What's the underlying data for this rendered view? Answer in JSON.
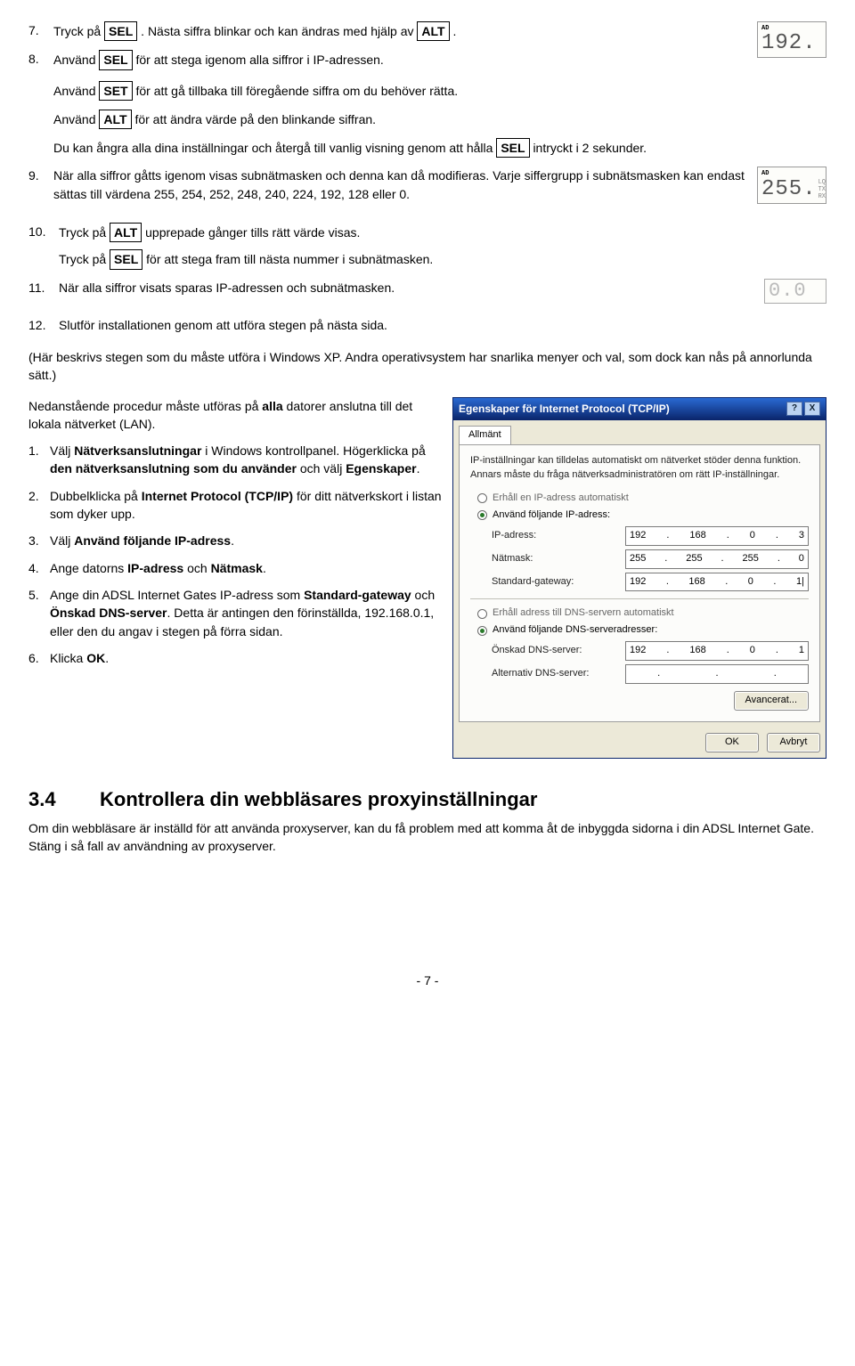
{
  "keys": {
    "SEL": "SEL",
    "ALT": "ALT",
    "SET": "SET"
  },
  "step7": {
    "num": "7.",
    "a": "Tryck på ",
    "b": ". Nästa siffra blinkar och kan ändras med hjälp av ",
    "c": "."
  },
  "step8": {
    "num": "8.",
    "a": "Använd ",
    "b": " för att stega igenom alla siffror i IP-adressen."
  },
  "p8a": {
    "a": "Använd ",
    "b": " för att gå tillbaka till föregående siffra om du behöver rätta."
  },
  "p8b": {
    "a": "Använd ",
    "b": " för att ändra värde på den blinkande siffran."
  },
  "p8c": {
    "a": "Du kan ångra alla dina inställningar och återgå till vanlig visning genom att hålla ",
    "b": " intryckt i 2 sekunder."
  },
  "step9": {
    "num": "9.",
    "text": "När alla siffror gåtts igenom visas subnätmasken och denna kan då modifieras. Varje siffergrupp i subnätsmasken kan endast sättas till värdena 255, 254, 252, 248, 240, 224, 192, 128 eller 0."
  },
  "step10": {
    "num": "10.",
    "a": "Tryck på ",
    "b": " upprepade gånger tills rätt värde visas.",
    "c": "Tryck på ",
    "d": " för att stega fram till nästa nummer i subnätmasken."
  },
  "step11": {
    "num": "11.",
    "text": "När alla siffror visats sparas IP-adressen och subnätmasken."
  },
  "step12": {
    "num": "12.",
    "text": "Slutför installationen genom att utföra stegen på nästa sida."
  },
  "lcd1": {
    "ad": "AD",
    "digits": "192."
  },
  "lcd2": {
    "ad": "AD",
    "digits": "255.",
    "s1": "LQ",
    "s2": "TX",
    "s3": "RX"
  },
  "lcd3": {
    "digits": "0.0"
  },
  "midpara": "(Här beskrivs stegen som du måste utföra i Windows XP. Andra operativsystem har snarlika menyer och val, som dock kan nås på annorlunda sätt.)",
  "leftIntroA": "Nedanstående procedur måste utföras på ",
  "leftIntroBold": "alla",
  "leftIntroB": " datorer anslutna till det lokala nätverket (LAN).",
  "win": {
    "s1": {
      "num": "1.",
      "a": "Välj ",
      "b1": "Nätverksanslutningar",
      "c": " i Windows kontrollpanel. Högerklicka på ",
      "b2": "den nätverksanslutning som du använder",
      "d": " och välj ",
      "b3": "Egenskaper",
      "e": "."
    },
    "s2": {
      "num": "2.",
      "a": "Dubbelklicka på ",
      "b1": "Internet Protocol (TCP/IP)",
      "c": " för ditt nätverkskort i listan som dyker upp."
    },
    "s3": {
      "num": "3.",
      "a": "Välj ",
      "b1": "Använd följande IP-adress",
      "c": "."
    },
    "s4": {
      "num": "4.",
      "a": "Ange datorns ",
      "b1": "IP-adress",
      "c": " och ",
      "b2": "Nätmask",
      "d": "."
    },
    "s5": {
      "num": "5.",
      "a": "Ange din ADSL Internet Gates IP-adress som ",
      "b1": "Standard-gateway",
      "c": " och ",
      "b2": "Önskad DNS-server",
      "d": ". Detta är antingen den förinställda, 192.168.0.1, eller den du angav i stegen på förra sidan."
    },
    "s6": {
      "num": "6.",
      "a": "Klicka ",
      "b1": "OK",
      "c": "."
    }
  },
  "dlg": {
    "title": "Egenskaper för Internet Protocol (TCP/IP)",
    "help": "?",
    "close": "X",
    "tab": "Allmänt",
    "intro": "IP-inställningar kan tilldelas automatiskt om nätverket stöder denna funktion. Annars måste du fråga nätverksadministratören om rätt IP-inställningar.",
    "r1": "Erhåll en IP-adress automatiskt",
    "r2": "Använd följande IP-adress:",
    "ipLbl": "IP-adress:",
    "ip": [
      "192",
      "168",
      "0",
      "3"
    ],
    "maskLbl": "Nätmask:",
    "mask": [
      "255",
      "255",
      "255",
      "0"
    ],
    "gwLbl": "Standard-gateway:",
    "gw": [
      "192",
      "168",
      "0",
      "1|"
    ],
    "r3": "Erhåll adress till DNS-servern automatiskt",
    "r4": "Använd följande DNS-serveradresser:",
    "dns1Lbl": "Önskad DNS-server:",
    "dns1": [
      "192",
      "168",
      "0",
      "1"
    ],
    "dns2Lbl": "Alternativ DNS-server:",
    "dns2": [
      "",
      "",
      "",
      ""
    ],
    "adv": "Avancerat...",
    "ok": "OK",
    "cancel": "Avbryt"
  },
  "section": {
    "num": "3.4",
    "title": "Kontrollera din webbläsares proxyinställningar"
  },
  "sectionText": "Om din webbläsare är inställd för att använda proxyserver, kan du få problem med att komma åt de inbyggda sidorna i din ADSL Internet Gate. Stäng i så fall av användning av proxyserver.",
  "pageNum": "- 7 -"
}
